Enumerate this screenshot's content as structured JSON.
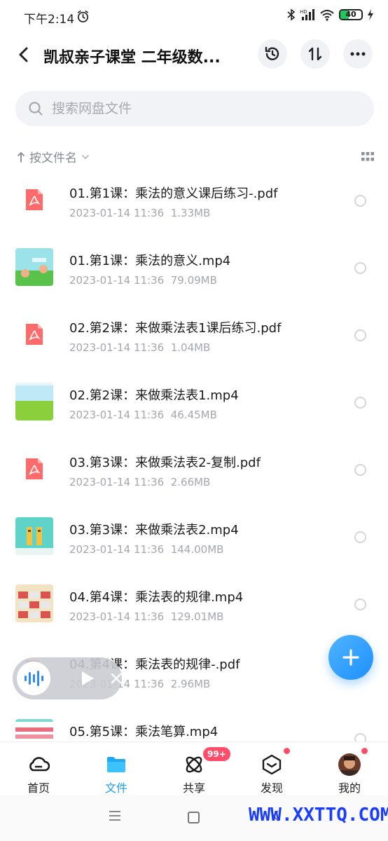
{
  "status_bar": {
    "time": "下午2:14",
    "battery_level": "40",
    "battery_fraction": 0.4,
    "network_label": "HD",
    "accent_battery": "#22c55e"
  },
  "header": {
    "title": "凯叔亲子课堂 二年级数...",
    "back_icon": "chevron-left-icon",
    "history_icon": "history-icon",
    "transfer_icon": "transfer-icon",
    "more_icon": "more-icon"
  },
  "search": {
    "placeholder": "搜索网盘文件",
    "value": ""
  },
  "sort": {
    "label": "按文件名",
    "view_icon": "grid-view-icon"
  },
  "files": [
    {
      "name": "01.第1课：乘法的意义课后练习-.pdf",
      "date": "2023-01-14  11:36",
      "size": "1.33MB",
      "kind": "pdf"
    },
    {
      "name": "01.第1课：乘法的意义.mp4",
      "date": "2023-01-14  11:36",
      "size": "79.09MB",
      "kind": "video"
    },
    {
      "name": "02.第2课：来做乘法表1课后练习.pdf",
      "date": "2023-01-14  11:36",
      "size": "1.04MB",
      "kind": "pdf"
    },
    {
      "name": "02.第2课：来做乘法表1.mp4",
      "date": "2023-01-14  11:36",
      "size": "46.45MB",
      "kind": "video"
    },
    {
      "name": "03.第3课：来做乘法表2-复制.pdf",
      "date": "2023-01-14  11:36",
      "size": "2.66MB",
      "kind": "pdf"
    },
    {
      "name": "03.第3课：来做乘法表2.mp4",
      "date": "2023-01-14  11:36",
      "size": "144.00MB",
      "kind": "video"
    },
    {
      "name": "04.第4课：乘法表的规律.mp4",
      "date": "2023-01-14  11:36",
      "size": "129.01MB",
      "kind": "video"
    },
    {
      "name": "04.第4课：乘法表的规律-.pdf",
      "date": "2023-01-14  11:36",
      "size": "2.96MB",
      "kind": "pdf"
    },
    {
      "name": "05.第5课：乘法笔算.mp4",
      "date": "",
      "size": "",
      "kind": "video"
    }
  ],
  "fab": {
    "icon": "plus-icon",
    "color": "#1e90ff"
  },
  "mini_player": {
    "wave_icon": "audio-wave-icon",
    "play_icon": "play-icon",
    "close_icon": "close-icon"
  },
  "tabs": [
    {
      "label": "首页",
      "icon": "home-cloud-icon",
      "active": false
    },
    {
      "label": "文件",
      "icon": "folder-icon",
      "active": true
    },
    {
      "label": "共享",
      "icon": "share-atom-icon",
      "active": false,
      "badge": "99+"
    },
    {
      "label": "发现",
      "icon": "discover-box-icon",
      "active": false,
      "dot": true
    },
    {
      "label": "我的",
      "icon": "avatar-icon",
      "active": false,
      "dot": true
    }
  ],
  "active_color": "#1a9cf2",
  "watermark": "WWW.XXTTQ.COM"
}
